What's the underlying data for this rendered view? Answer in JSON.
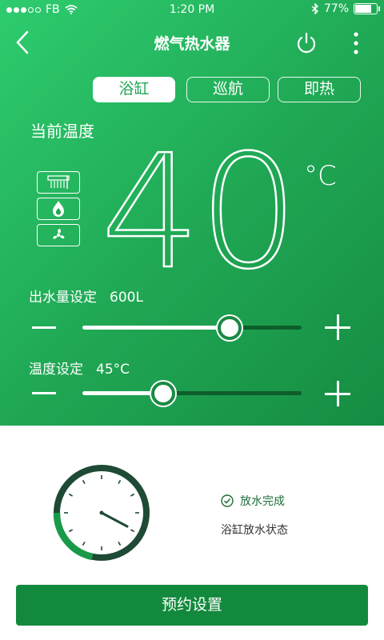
{
  "status_bar": {
    "carrier": "FB",
    "time": "1:20 PM",
    "battery": "77%",
    "battery_level": 0.77
  },
  "nav": {
    "title": "燃气热水器",
    "icons": [
      "back-arrow-icon",
      "power-icon",
      "more-vertical-icon"
    ]
  },
  "tabs": [
    {
      "label": "浴缸",
      "active": true
    },
    {
      "label": "巡航",
      "active": false
    },
    {
      "label": "即热",
      "active": false
    }
  ],
  "current": {
    "label": "当前温度",
    "value": "40",
    "unit": "°C"
  },
  "mode_icons": [
    "shower-icon",
    "flame-icon",
    "fan-icon"
  ],
  "water_volume": {
    "label": "出水量设定",
    "value": "600L",
    "level": 0.67
  },
  "temperature_setting": {
    "label": "温度设定",
    "value": "45°C",
    "level": 0.37
  },
  "bath_status": {
    "status": "放水完成",
    "description": "浴缸放水状态"
  },
  "reserve_button": "预约设置",
  "colors": {
    "accent": "#1fa653",
    "button": "#13893d",
    "clock_dark": "#1f4a35",
    "clock_green": "#1a9a49"
  }
}
